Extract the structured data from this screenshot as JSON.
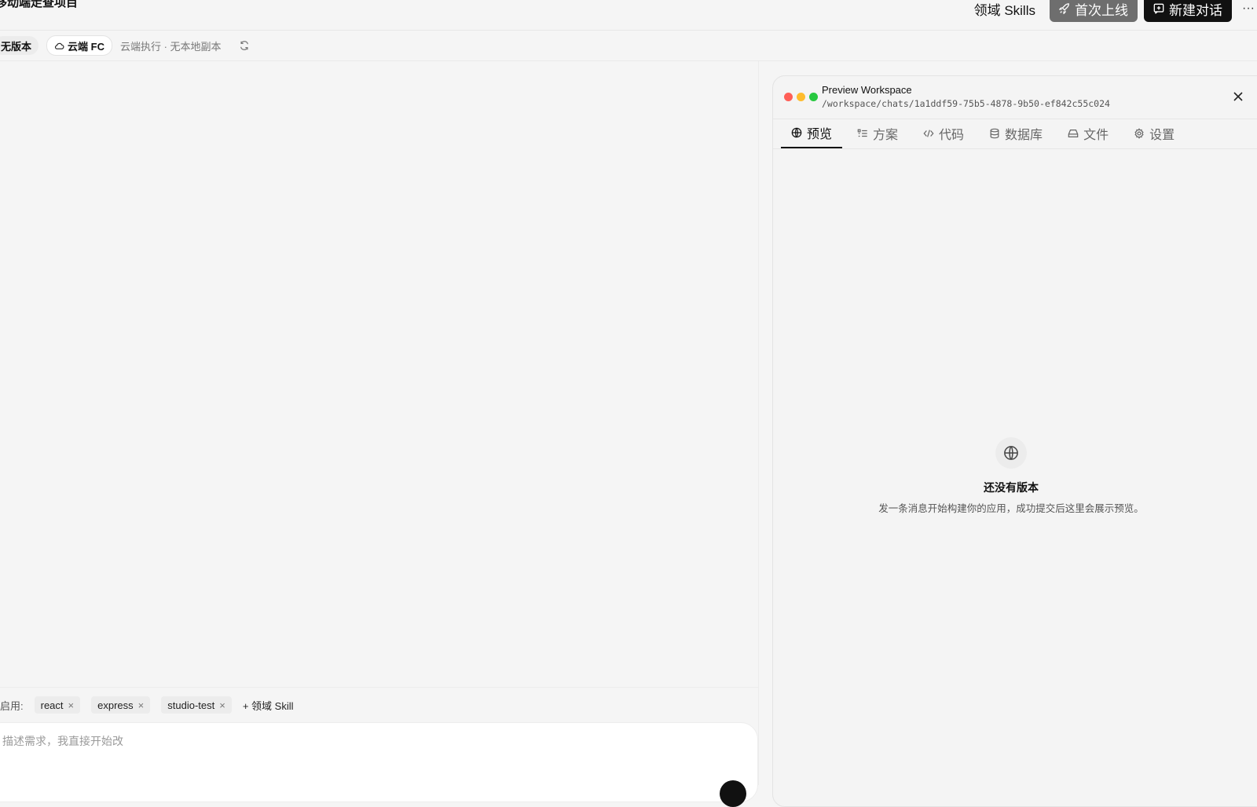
{
  "header": {
    "project_title": "移动端走查项目",
    "skills_link": "领域 Skills",
    "launch_label": "首次上线",
    "new_chat_label": "新建对话",
    "more_label": "···"
  },
  "toolbar": {
    "version_chip": "无版本",
    "runtime_chip": "云端 FC",
    "runtime_note": "云端执行 · 无本地副本"
  },
  "skills_bar": {
    "label": "启用:",
    "skills": [
      {
        "name": "react"
      },
      {
        "name": "express"
      },
      {
        "name": "studio-test"
      }
    ],
    "remove_glyph": "×",
    "add_label": "+ 领域 Skill"
  },
  "composer": {
    "placeholder": "描述需求，我直接开始改"
  },
  "preview": {
    "title": "Preview Workspace",
    "path": "/workspace/chats/1a1ddf59-75b5-4878-9b50-ef842c55c024",
    "tabs": [
      {
        "label": "预览",
        "icon": "globe-icon",
        "active": true
      },
      {
        "label": "方案",
        "icon": "list-icon",
        "active": false
      },
      {
        "label": "代码",
        "icon": "code-icon",
        "active": false
      },
      {
        "label": "数据库",
        "icon": "database-icon",
        "active": false
      },
      {
        "label": "文件",
        "icon": "drive-icon",
        "active": false
      },
      {
        "label": "设置",
        "icon": "gear-icon",
        "active": false
      }
    ],
    "empty_title": "还没有版本",
    "empty_subtitle": "发一条消息开始构建你的应用，成功提交后这里会展示预览。"
  },
  "colors": {
    "background": "#f5f5f5",
    "primary_button": "#111111",
    "secondary_button": "#6e6e6e",
    "traffic_red": "#ff5f57",
    "traffic_yellow": "#febc2e",
    "traffic_green": "#28c840"
  }
}
